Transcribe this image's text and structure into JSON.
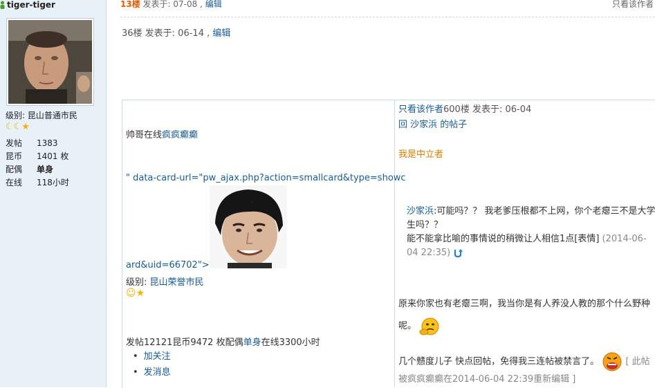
{
  "sidebar": {
    "username": "tiger-tiger",
    "level_label": "级别: ",
    "level_value": "昆山普通市民",
    "stats": [
      {
        "key": "发帖",
        "value": "1383"
      },
      {
        "key": "昆币",
        "value": "1401 枚"
      },
      {
        "key": "配偶",
        "value": "单身"
      },
      {
        "key": "在线",
        "value": "118小时"
      }
    ]
  },
  "floor13": {
    "floor": "13楼",
    "posted": " 发表于: 07-08 , ",
    "edit": "编辑",
    "only_author": "只看该作者"
  },
  "floor36": {
    "text": "36楼 发表于: 06-14 , ",
    "edit": "编辑"
  },
  "left_cell": {
    "online_prefix": "帅哥在线",
    "online_name": "疯疯癫癫",
    "card_line1": "\" data-card-url=\"pw_ajax.php?action=smallcard&type=showc",
    "card_line2": "ard&uid=66702\">",
    "level_label": "级别: ",
    "level_value": "昆山荣誉市民",
    "stats_prefix": "发帖12121昆币9472 枚配偶",
    "stats_spouse": "单身",
    "stats_suffix": "在线3300小时",
    "actions": [
      "加关注",
      "发消息"
    ]
  },
  "right_cell": {
    "only_author": "只看该作者",
    "post_meta": "600楼 发表于: 06-04",
    "reply_to": "回 沙家浜 的帖子",
    "neutral": "我是中立者",
    "quote_author": "沙家浜",
    "quote_text1": ":可能吗？？ 我老爹压根都不上网，你个老瘪三不是大学生吗？？",
    "quote_text2": "能不能拿比喻的事情说的稍微让人相信1点[表情]",
    "quote_time": " (2014-06-04 22:35)",
    "reply1": "原来你家也有老瘪三啊，我当你是有人养没人教的那个什么野种呢。",
    "reply2": "几个戆度儿子 快点回帖，免得我三连帖被禁言了。",
    "edit_note": "[ 此帖被疯疯癫癫在2014-06-04 22:39重新编辑 ]"
  }
}
